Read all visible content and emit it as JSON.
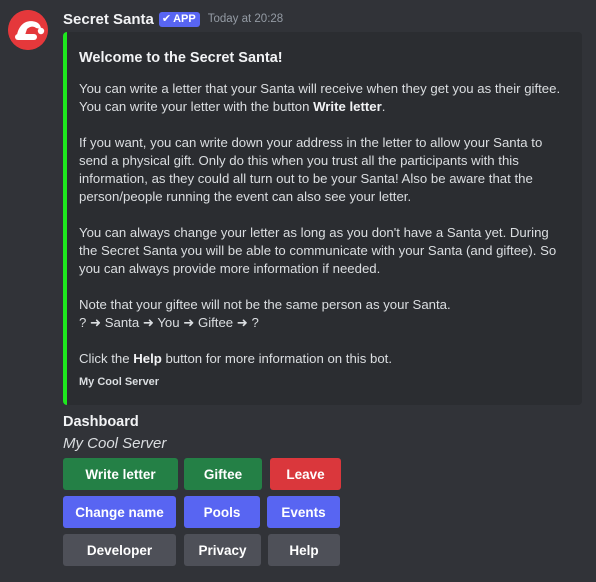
{
  "author": {
    "name": "Secret Santa",
    "tag": "APP",
    "timestamp": "Today at 20:28",
    "avatar_icon": "santa-hat-icon"
  },
  "embed": {
    "accent_color": "#1ee81e",
    "title": "Welcome to the Secret Santa!",
    "p1_a": "You can write a letter that your Santa will receive when they get you as their giftee. You can write your letter with the button ",
    "p1_b": "Write letter",
    "p1_c": ".",
    "p2": "If you want, you can write down your address in the letter to allow your Santa to send a physical gift. Only do this when you trust all the participants with this information, as they could all turn out to be your Santa! Also be aware that the person/people running the event can also see your letter.",
    "p3": "You can always change your letter as long as you don't have a Santa yet. During the Secret Santa you will be able to communicate with your Santa (and giftee). So you can always provide more information if needed.",
    "p4_line1": "Note that your giftee will not be the same person as your Santa.",
    "p4_line2": "? ➜ Santa ➜ You ➜ Giftee ➜ ?",
    "p5_a": "Click the ",
    "p5_b": "Help",
    "p5_c": " button for more information on this bot.",
    "footer": "My Cool Server"
  },
  "dashboard": {
    "title": "Dashboard",
    "subtitle": "My Cool Server"
  },
  "buttons": {
    "write_letter": "Write letter",
    "giftee": "Giftee",
    "leave": "Leave",
    "change_name": "Change name",
    "pools": "Pools",
    "events": "Events",
    "developer": "Developer",
    "privacy": "Privacy",
    "help": "Help"
  },
  "colors": {
    "background": "#313338",
    "embed_bg": "#2b2d31",
    "success": "#248046",
    "danger": "#da373c",
    "primary": "#5865f2",
    "secondary": "#4e5058"
  }
}
